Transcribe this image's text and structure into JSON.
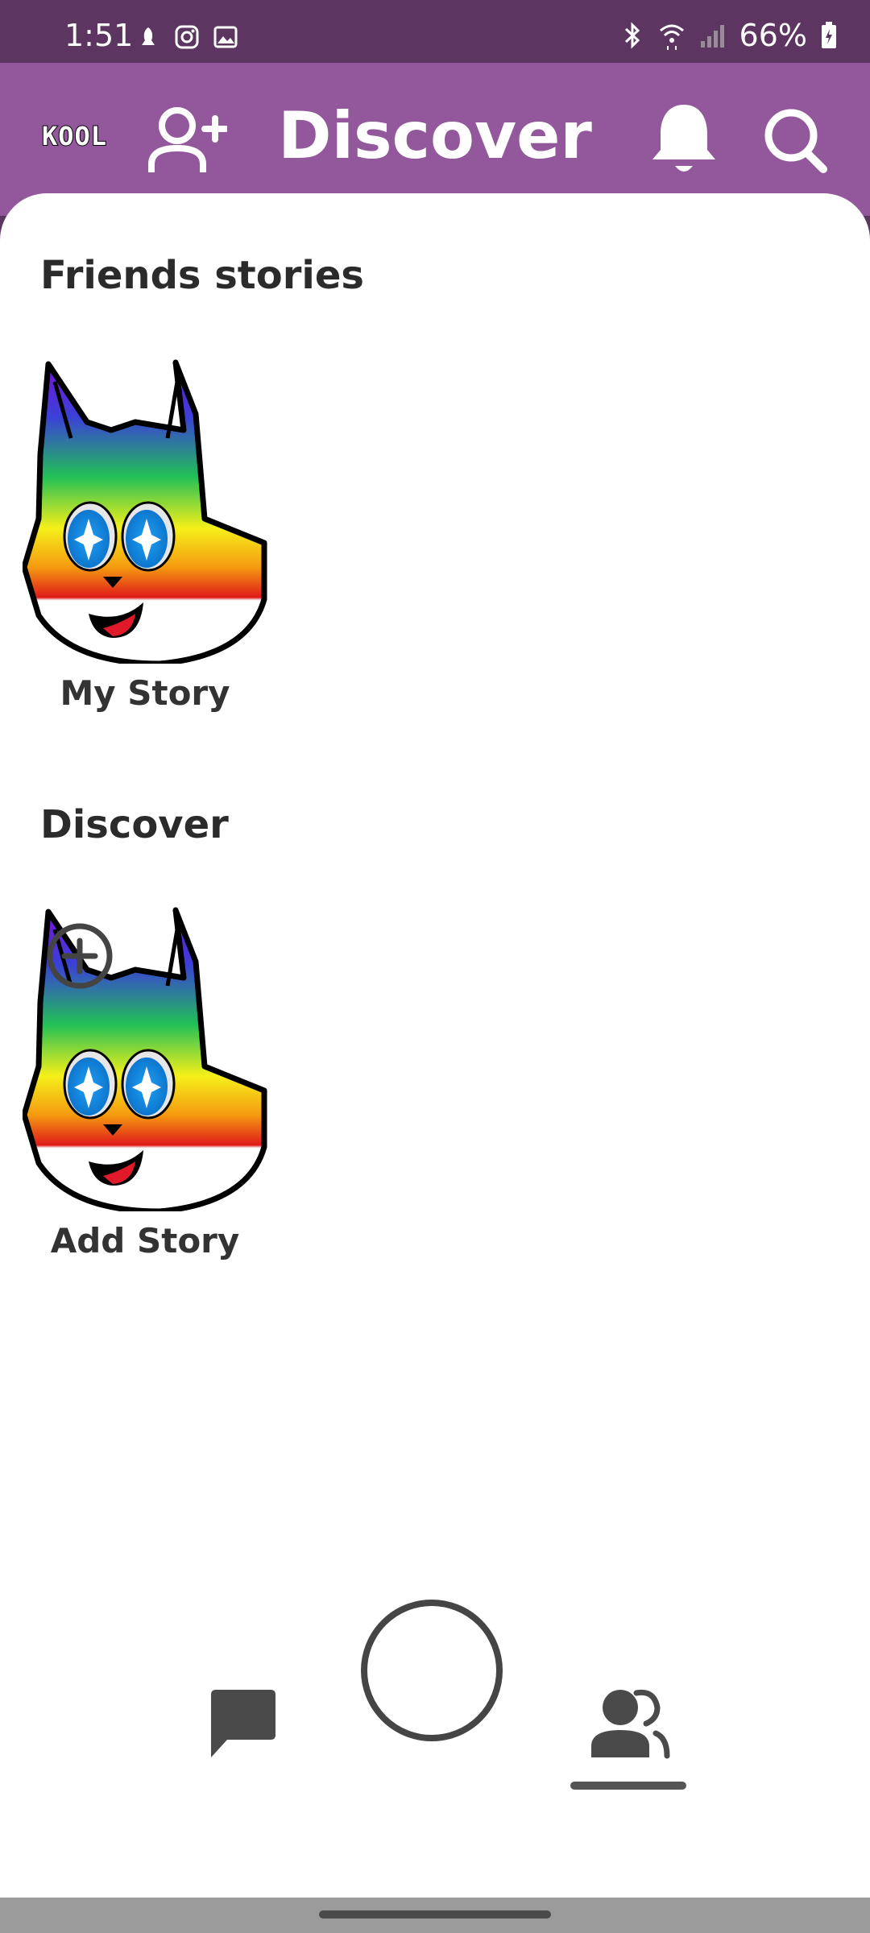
{
  "status_bar": {
    "time": "1:51",
    "battery": "66%",
    "left_icons": [
      "notification-icon",
      "instagram-icon",
      "gallery-icon"
    ],
    "right_icons": [
      "bluetooth-icon",
      "wifi-icon",
      "signal-icon",
      "battery-icon"
    ]
  },
  "app_bar": {
    "logo": "KOOL",
    "title": "Discover",
    "background": "#93579b"
  },
  "sections": {
    "friends": {
      "title": "Friends stories",
      "story_label": "My Story"
    },
    "discover": {
      "title": "Discover",
      "story_label": "Add Story"
    }
  },
  "bottom_nav": {
    "items": [
      "chat-icon",
      "camera-button",
      "friends-icon"
    ],
    "selected": "friends-icon"
  }
}
